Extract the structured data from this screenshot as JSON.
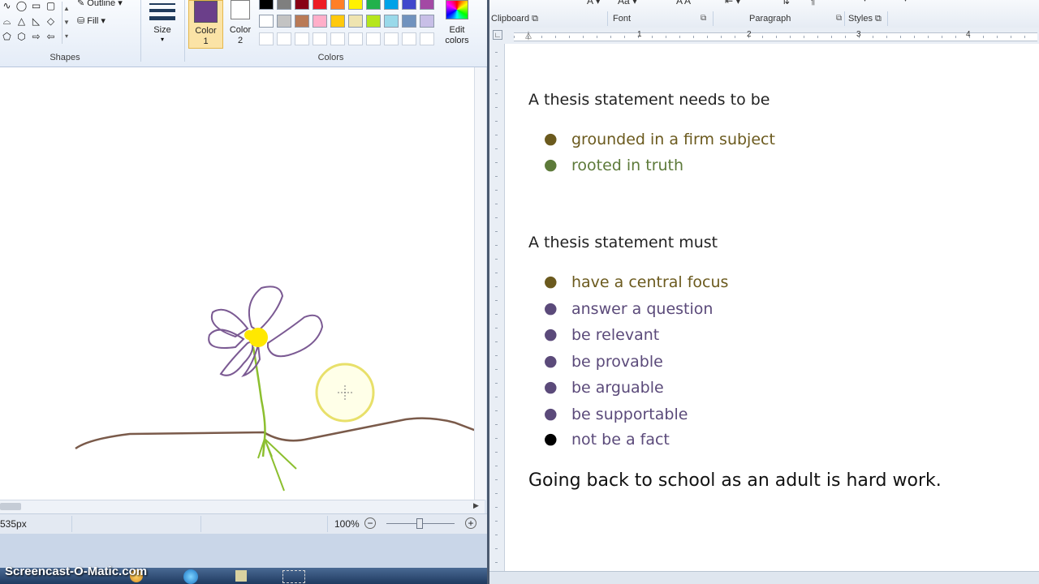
{
  "paint": {
    "groups": {
      "shapes": "Shapes",
      "colors": "Colors"
    },
    "outline_label": "Outline",
    "fill_label": "Fill",
    "size_label": "Size",
    "color1_label": "Color",
    "color1_sub": "1",
    "color2_label": "Color",
    "color2_sub": "2",
    "edit_colors_label": "Edit",
    "edit_colors_sub": "colors",
    "color1_value": "#6b3f8a",
    "palette_row1": [
      "#000000",
      "#7f7f7f",
      "#880015",
      "#ed1c24",
      "#ff7f27",
      "#fff200",
      "#22b14c",
      "#00a2e8",
      "#3f48cc",
      "#a349a4"
    ],
    "palette_row2": [
      "#ffffff",
      "#c3c3c3",
      "#b97a57",
      "#ffaec9",
      "#ffc90e",
      "#efe4b0",
      "#b5e61d",
      "#99d9ea",
      "#7092be",
      "#c8bfe7"
    ],
    "status_size": "535px",
    "zoom": "100%"
  },
  "word": {
    "ribbon_groups": [
      "Clipboard",
      "Font",
      "Paragraph",
      "Styles"
    ],
    "ruler_marks": [
      "1",
      "2",
      "3",
      "4"
    ],
    "heading1": "A thesis statement needs to be",
    "list1": [
      {
        "text": "grounded in a firm subject",
        "color": "#6b5a1e"
      },
      {
        "text": "rooted in truth",
        "color": "#5d7a3a"
      }
    ],
    "heading2": "A thesis statement must",
    "list2": [
      {
        "text": "have a central focus",
        "color": "#6b5a1e"
      },
      {
        "text": "answer a question",
        "color": "#5b4a7a"
      },
      {
        "text": "be relevant",
        "color": "#5b4a7a"
      },
      {
        "text": "be provable",
        "color": "#5b4a7a"
      },
      {
        "text": "be arguable",
        "color": "#5b4a7a"
      },
      {
        "text": "be supportable",
        "color": "#5b4a7a"
      },
      {
        "text": "not be a fact",
        "color": "#5b4a7a"
      }
    ],
    "closing": "Going back to school as an adult is hard work."
  },
  "watermark": "Screencast-O-Matic.com"
}
